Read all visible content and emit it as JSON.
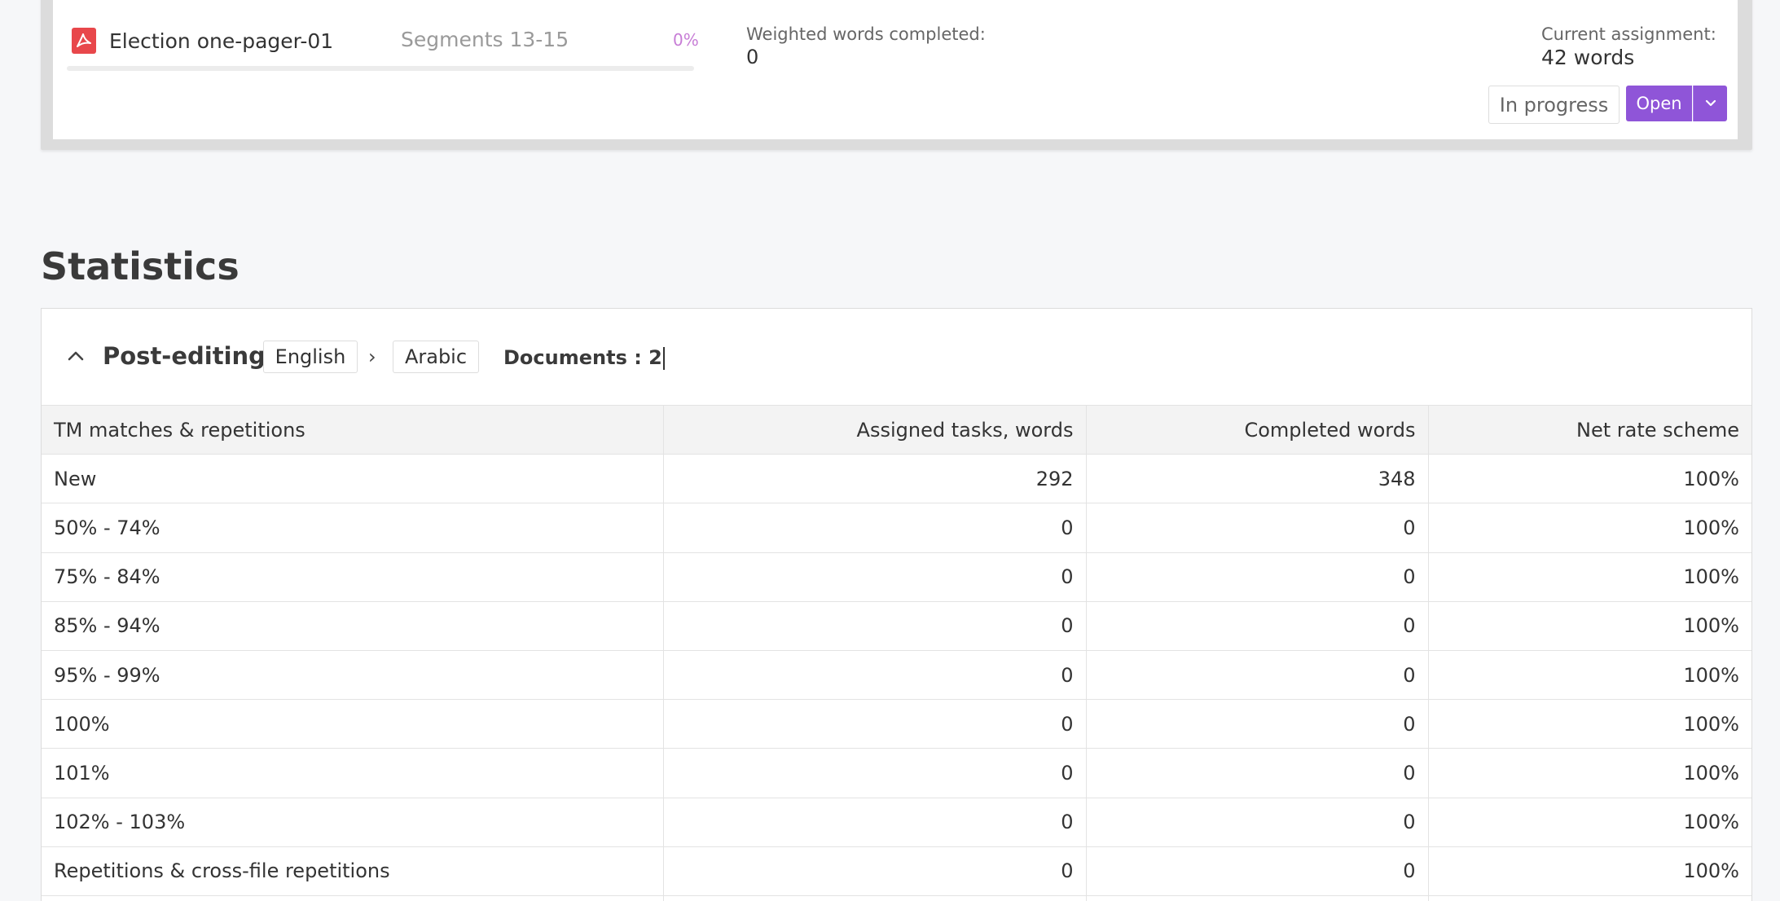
{
  "document": {
    "icon": "pdf-icon",
    "name": "Election one-pager-01",
    "segments": "Segments 13-15",
    "progress_percent": "0%",
    "progress_value": 0,
    "weighted_label": "Weighted words completed:",
    "weighted_value": "0",
    "assignment_label": "Current assignment:",
    "assignment_value": "42 words",
    "status_label": "In progress",
    "open_label": "Open",
    "colors": {
      "accent": "#8f55d8",
      "pdf": "#e8474b",
      "percent": "#c77dd6"
    }
  },
  "statistics": {
    "title": "Statistics",
    "stage": "Post-editing",
    "source_language": "English",
    "arrow": "›",
    "target_language": "Arabic",
    "documents_label": "Documents : 2",
    "table": {
      "headers": [
        "TM matches & repetitions",
        "Assigned tasks, words",
        "Completed words",
        "Net rate scheme"
      ],
      "rows": [
        [
          "New",
          "292",
          "348",
          "100%"
        ],
        [
          "50% - 74%",
          "0",
          "0",
          "100%"
        ],
        [
          "75% - 84%",
          "0",
          "0",
          "100%"
        ],
        [
          "85% - 94%",
          "0",
          "0",
          "100%"
        ],
        [
          "95% - 99%",
          "0",
          "0",
          "100%"
        ],
        [
          "100%",
          "0",
          "0",
          "100%"
        ],
        [
          "101%",
          "0",
          "0",
          "100%"
        ],
        [
          "102% - 103%",
          "0",
          "0",
          "100%"
        ],
        [
          "Repetitions & cross-file repetitions",
          "0",
          "0",
          "100%"
        ],
        [
          "",
          "",
          "",
          ""
        ]
      ]
    }
  }
}
